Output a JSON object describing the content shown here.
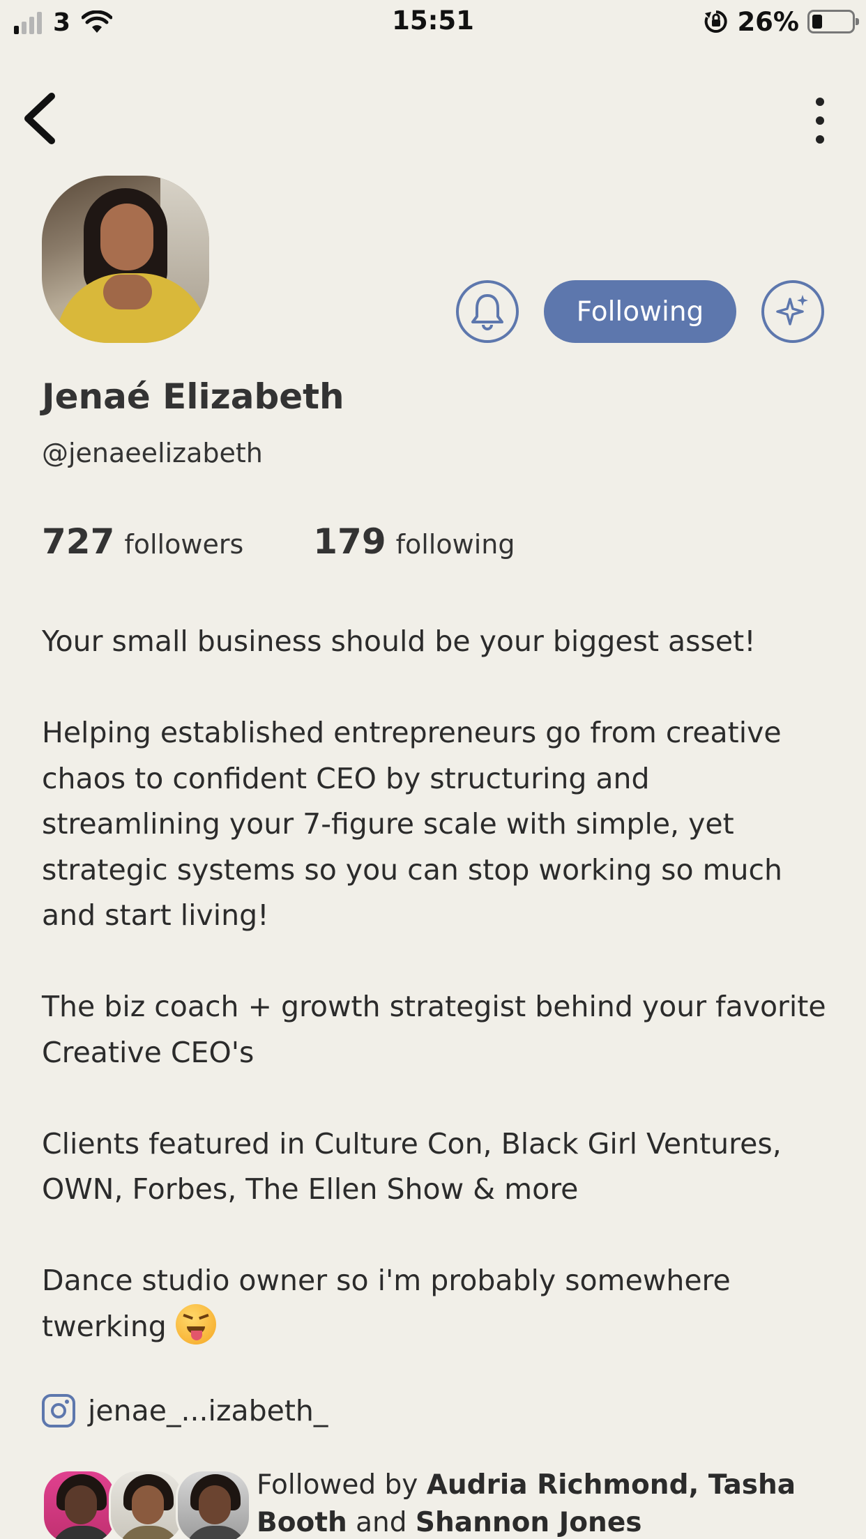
{
  "status_bar": {
    "carrier": "3",
    "time": "15:51",
    "battery_percent": "26%",
    "battery_level": 0.26,
    "signal_bars_active": 1,
    "signal_bars_total": 4,
    "icons": [
      "signal-icon",
      "wifi-icon",
      "orientation-lock-icon",
      "battery-icon"
    ]
  },
  "nav": {
    "back_icon": "chevron-left-icon",
    "more_icon": "more-vertical-icon"
  },
  "profile": {
    "name": "Jenaé Elizabeth",
    "handle": "@jenaeelizabeth",
    "followers_count": "727",
    "followers_label": "followers",
    "following_count": "179",
    "following_label": "following"
  },
  "actions": {
    "bell_icon": "bell-icon",
    "following_label": "Following",
    "sparkle_icon": "sparkle-icon",
    "accent_color": "#5d77ad"
  },
  "bio": {
    "paragraphs": [
      "Your small business should be your biggest asset!",
      "Helping established entrepreneurs go from creative chaos to confident CEO by structuring and streamlining your 7-figure scale with simple, yet strategic systems so you can stop working so much and start living!",
      "The biz coach + growth strategist behind your favorite Creative CEO's",
      "Clients featured in Culture Con, Black Girl Ventures, OWN, Forbes, The Ellen Show & more",
      "Dance studio owner so i'm probably somewhere twerking"
    ],
    "emoji": "squinting-face-with-tongue"
  },
  "instagram": {
    "icon": "instagram-icon",
    "handle": "jenae_...izabeth_"
  },
  "followed_by": {
    "prefix": "Followed by",
    "names_first": "Audria Richmond, Tasha Booth",
    "conjunction": "and",
    "names_last": "Shannon Jones"
  },
  "colors": {
    "background": "#f1efe8",
    "accent": "#5d77ad",
    "text": "#2b2b2b"
  }
}
